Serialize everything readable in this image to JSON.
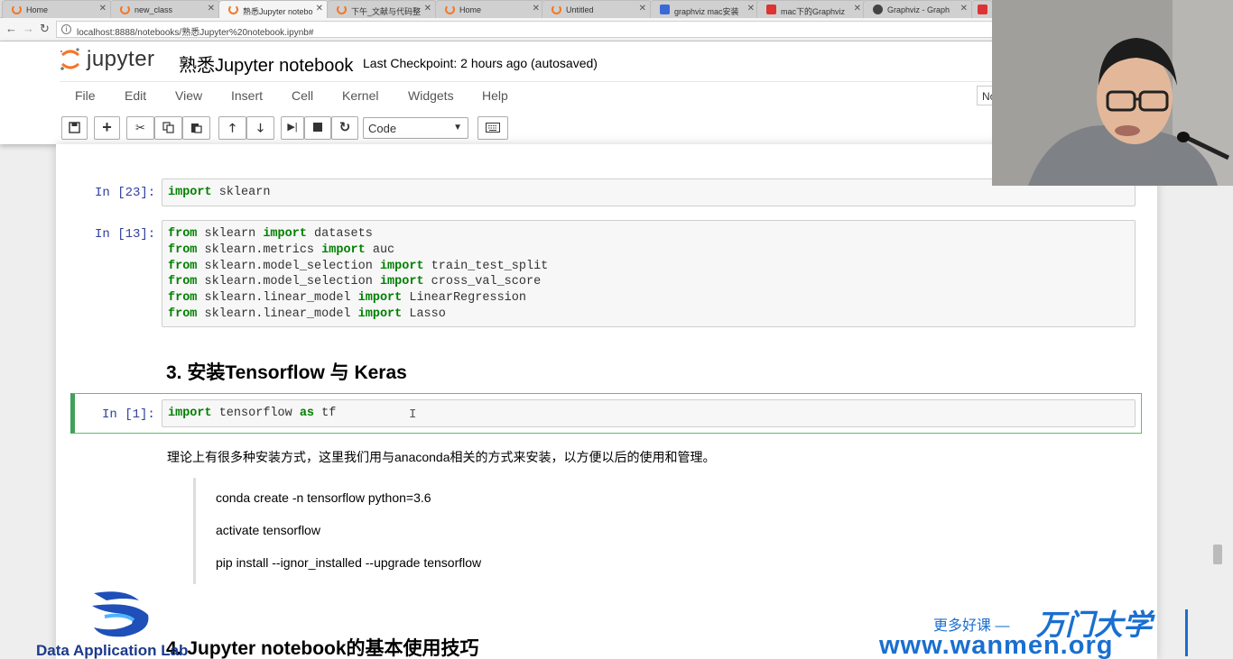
{
  "browser": {
    "tabs": [
      {
        "label": "Home",
        "icon": "jupyter-icon",
        "active": false
      },
      {
        "label": "new_class",
        "icon": "jupyter-icon",
        "active": false
      },
      {
        "label": "熟悉Jupyter notebo",
        "icon": "jupyter-icon",
        "active": true
      },
      {
        "label": "下午_文献与代码整",
        "icon": "jupyter-icon",
        "active": false
      },
      {
        "label": "Home",
        "icon": "jupyter-icon",
        "active": false
      },
      {
        "label": "Untitled",
        "icon": "jupyter-icon",
        "active": false
      },
      {
        "label": "graphviz mac安装",
        "icon": "baidu-icon",
        "active": false
      },
      {
        "label": "mac下的Graphviz",
        "icon": "csdn-icon",
        "active": false
      },
      {
        "label": "Graphviz - Graph",
        "icon": "github-icon",
        "active": false
      }
    ],
    "url": "localhost:8888/notebooks/熟悉Jupyter%20notebook.ipynb#"
  },
  "jupyter": {
    "logo_text": "jupyter",
    "notebook_title": "熟悉Jupyter notebook",
    "checkpoint": "Last Checkpoint: 2 hours ago (autosaved)",
    "menu": [
      "File",
      "Edit",
      "View",
      "Insert",
      "Cell",
      "Kernel",
      "Widgets",
      "Help"
    ],
    "kernel_box": "No",
    "cell_type": "Code"
  },
  "cells": {
    "c23_prompt": "In [23]:",
    "c13_prompt": "In [13]:",
    "c1_prompt": "In [1]:",
    "heading3": "3. 安装Tensorflow 与 Keras",
    "para": "理论上有很多种安装方式，这里我们用与anaconda相关的方式来安装，以方便以后的使用和管理。",
    "quote": [
      "conda create -n tensorflow python=3.6",
      "activate tensorflow",
      "pip install --ignor_installed --upgrade tensorflow"
    ],
    "heading4": "4. Jupyter notebook的基本使用技巧"
  },
  "watermark": {
    "dal": "Data Application Lab",
    "tagline": "更多好课 —",
    "brand": "万门大学",
    "site": "www.wanmen.org"
  }
}
